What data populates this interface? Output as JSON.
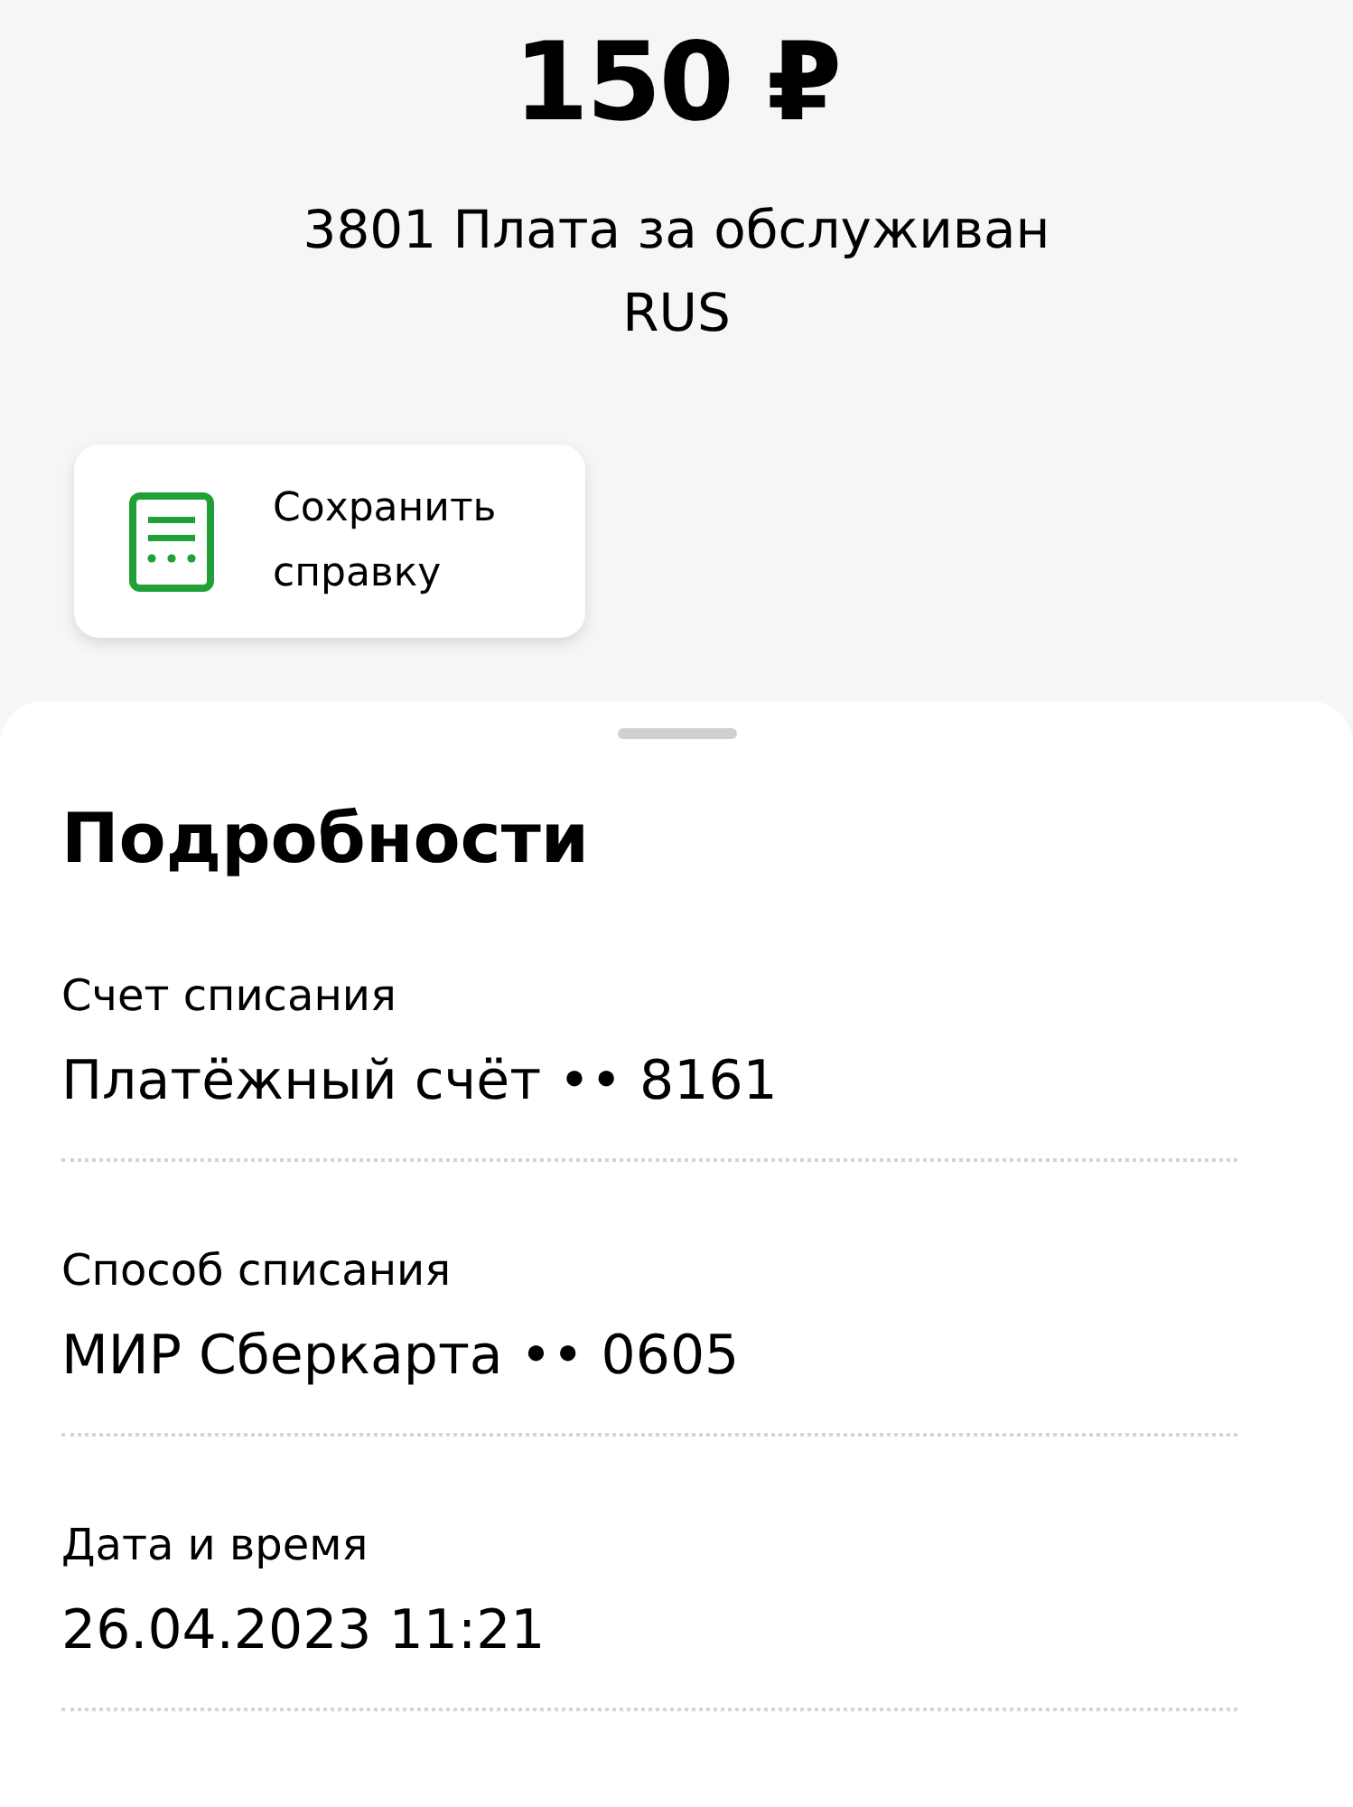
{
  "amount": "150 ₽",
  "description_lines": [
    "3801 Плата за обслуживан",
    "RUS"
  ],
  "save_button": {
    "label_lines": [
      "Сохранить",
      "справку"
    ]
  },
  "details": {
    "title": "Подробности",
    "rows": [
      {
        "label": "Счет списания",
        "value": "Платёжный счёт •• 8161"
      },
      {
        "label": "Способ списания",
        "value": "МИР Сберкарта •• 0605"
      },
      {
        "label": "Дата и время",
        "value": "26.04.2023 11:21"
      }
    ]
  }
}
